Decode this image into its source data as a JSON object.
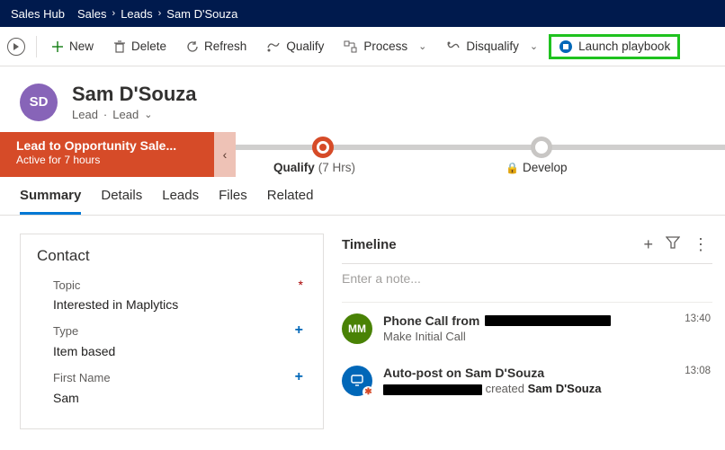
{
  "nav": {
    "app": "Sales Hub",
    "crumbs": [
      "Sales",
      "Leads",
      "Sam D'Souza"
    ]
  },
  "commands": {
    "new": "New",
    "delete": "Delete",
    "refresh": "Refresh",
    "qualify": "Qualify",
    "process": "Process",
    "disqualify": "Disqualify",
    "launch_playbook": "Launch playbook"
  },
  "record": {
    "initials": "SD",
    "name": "Sam D'Souza",
    "entity": "Lead",
    "subentity": "Lead"
  },
  "process": {
    "name": "Lead to Opportunity Sale...",
    "active": "Active for 7 hours",
    "stage1": "Qualify",
    "stage1_dur": "(7 Hrs)",
    "stage2": "Develop"
  },
  "tabs": [
    "Summary",
    "Details",
    "Leads",
    "Files",
    "Related"
  ],
  "contact": {
    "heading": "Contact",
    "fields": {
      "topic_label": "Topic",
      "topic_value": "Interested in Maplytics",
      "type_label": "Type",
      "type_value": "Item based",
      "firstname_label": "First Name",
      "firstname_value": "Sam"
    }
  },
  "timeline": {
    "heading": "Timeline",
    "note_placeholder": "Enter a note...",
    "items": [
      {
        "avatar": "MM",
        "title_prefix": "Phone Call from",
        "subtitle": "Make Initial Call",
        "time": "13:40"
      },
      {
        "title": "Auto-post on Sam D'Souza",
        "sub_suffix": "created",
        "sub_name": "Sam D'Souza",
        "time": "13:08"
      }
    ]
  }
}
